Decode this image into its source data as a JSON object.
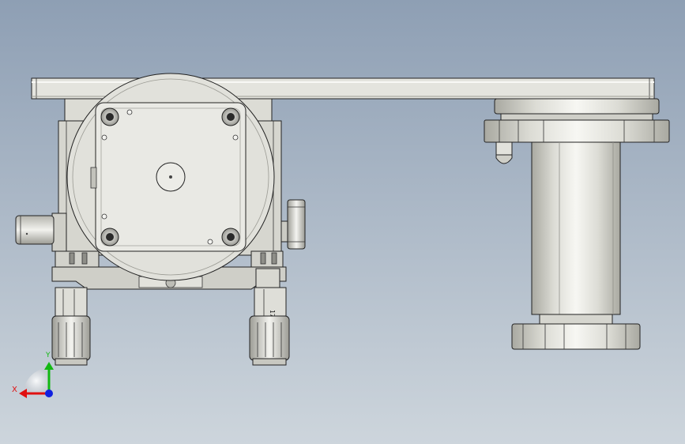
{
  "viewport": {
    "bg_top": "#8e9fb4",
    "bg_bottom": "#cdd5dc"
  },
  "part": {
    "metal_light": "#f2f2ee",
    "metal_mid": "#d9d9d2",
    "metal_dark": "#a9a9a1",
    "edge": "#222222"
  },
  "knob_marking": "17",
  "triad": {
    "x_label": "X",
    "y_label": "Y",
    "x_color": "#e01010",
    "y_color": "#12b812",
    "z_color": "#1020e0"
  }
}
